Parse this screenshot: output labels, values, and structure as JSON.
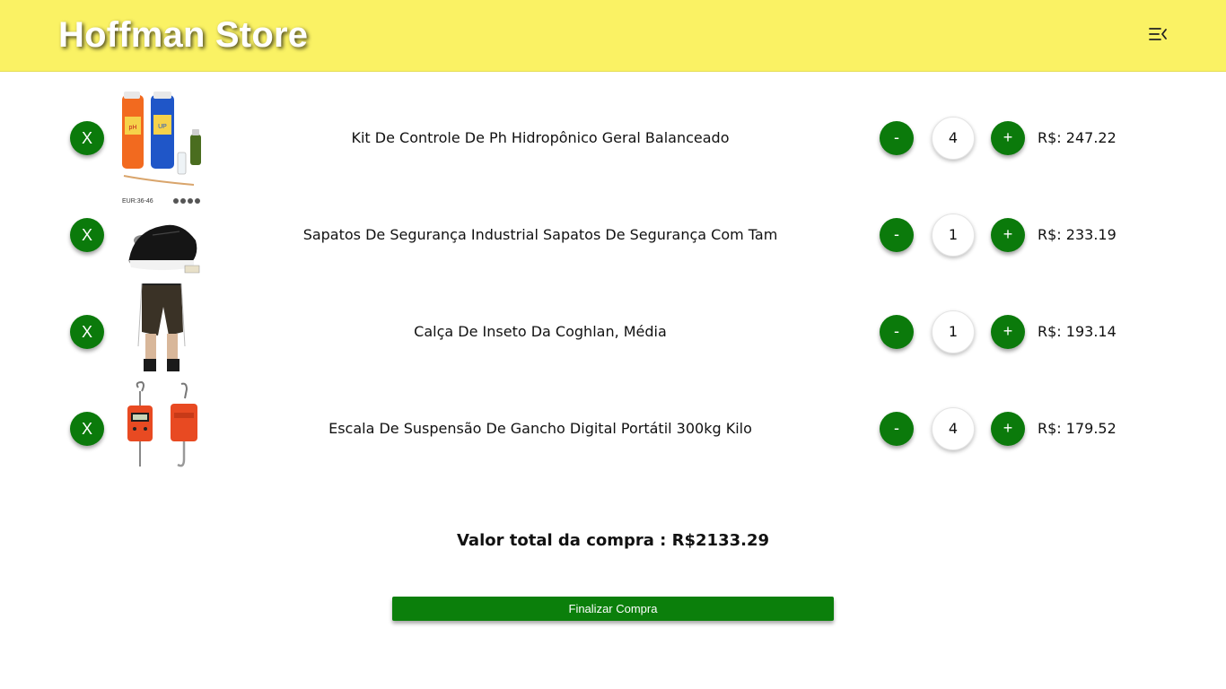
{
  "header": {
    "brand": "Hoffman Store",
    "menu_icon": "menu-collapse-icon",
    "background": "#faf264"
  },
  "cart": {
    "remove_label": "X",
    "minus_label": "-",
    "plus_label": "+",
    "items": [
      {
        "name": "Kit De Controle De Ph Hidropônico Geral Balanceado",
        "quantity": "4",
        "price": "R$: 247.22",
        "image": "ph-control-kit-image"
      },
      {
        "name": "Sapatos De Segurança Industrial Sapatos De Segurança Com Tam",
        "quantity": "1",
        "price": "R$: 233.19",
        "image": "safety-shoes-image"
      },
      {
        "name": "Calça De Inseto Da Coghlan, Média",
        "quantity": "1",
        "price": "R$: 193.14",
        "image": "insect-pants-image"
      },
      {
        "name": "Escala De Suspensão De Gancho Digital Portátil 300kg Kilo",
        "quantity": "4",
        "price": "R$: 179.52",
        "image": "hanging-scale-image"
      }
    ],
    "total_text": "Valor total da compra : R$2133.29",
    "checkout_label": "Finalizar Compra",
    "accent_color": "#0b7a0b"
  }
}
